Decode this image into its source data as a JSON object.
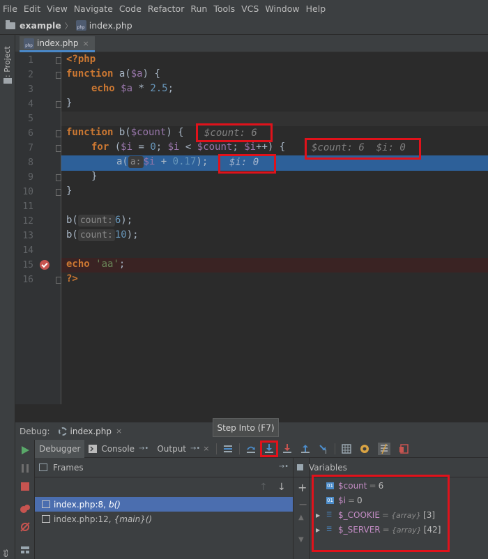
{
  "menu": [
    "File",
    "Edit",
    "View",
    "Navigate",
    "Code",
    "Refactor",
    "Run",
    "Tools",
    "VCS",
    "Window",
    "Help"
  ],
  "nav": {
    "project": "example",
    "file": "index.php"
  },
  "left_strip": {
    "project_label": "1: Project",
    "bottom_label": "es"
  },
  "editor_tab": {
    "label": "index.php",
    "close": "×"
  },
  "editor": {
    "line_numbers": [
      "1",
      "2",
      "3",
      "4",
      "5",
      "6",
      "7",
      "8",
      "9",
      "10",
      "11",
      "12",
      "13",
      "14",
      "15",
      "16"
    ],
    "line1": "<?php",
    "line2_kw": "function",
    "line2_rest": " a(",
    "line2_var": "$a",
    "line2_end": ") {",
    "line3_kw": "echo",
    "line3_var": "$a",
    "line3_rest": " * ",
    "line3_num": "2.5",
    "line3_end": ";",
    "line4": "}",
    "line6_kw": "function",
    "line6_rest": " b(",
    "line6_var": "$count",
    "line6_end": ") {",
    "line6_hint": "$count: 6",
    "line7_kw": "for",
    "line7_a": " (",
    "line7_v1": "$i",
    "line7_b": " = ",
    "line7_n": "0",
    "line7_c": "; ",
    "line7_v2": "$i",
    "line7_d": " < ",
    "line7_v3": "$count",
    "line7_e": "; ",
    "line7_v4": "$i",
    "line7_f": "++) {",
    "line7_hint": "$count: 6  $i: 0",
    "line8_a": "a(",
    "line8_param": "a:",
    "line8_var": "$i",
    "line8_rest": " + ",
    "line8_num": "0.17",
    "line8_end": ");",
    "line8_hint": "$i: 0",
    "line9": "}",
    "line10": "}",
    "line12_a": "b(",
    "line12_param": "count:",
    "line12_num": "6",
    "line12_end": ");",
    "line13_a": "b(",
    "line13_param": "count:",
    "line13_num": "10",
    "line13_end": ");",
    "line15_kw": "echo",
    "line15_str": "'aa'",
    "line15_end": ";",
    "line16": "?>"
  },
  "debug": {
    "title": "Debug:",
    "session": "index.php",
    "tooltip": "Step Into (F7)",
    "tabs": {
      "debugger": "Debugger",
      "console": "Console",
      "output": "Output"
    },
    "frames_title": "Frames",
    "variables_title": "Variables",
    "frames": [
      {
        "file": "index.php:8,",
        "func": "b()"
      },
      {
        "file": "index.php:12,",
        "func": "{main}()"
      }
    ],
    "variables": [
      {
        "name": "$count",
        "eq": " = ",
        "value": "6",
        "kind": "scalar"
      },
      {
        "name": "$i",
        "eq": " = ",
        "value": "0",
        "kind": "scalar"
      },
      {
        "name": "$_COOKIE",
        "eq": " = ",
        "type": "{array}",
        "value": "[3]",
        "kind": "array"
      },
      {
        "name": "$_SERVER",
        "eq": " = ",
        "type": "{array}",
        "value": "[42]",
        "kind": "array"
      }
    ]
  },
  "colors": {
    "highlight_box": "#e0121b",
    "execution_line": "#2d6099",
    "breakpoint": "#c75450"
  }
}
